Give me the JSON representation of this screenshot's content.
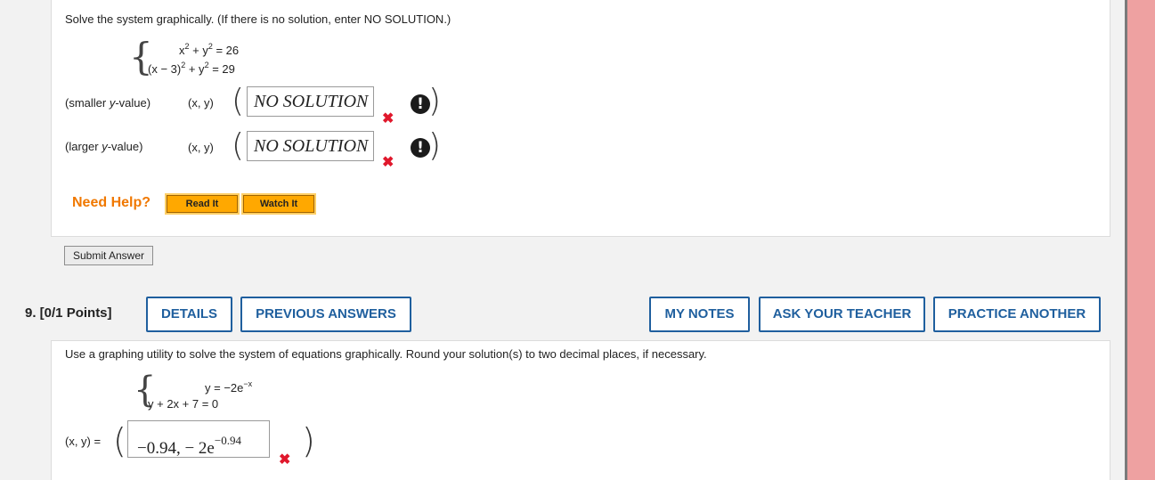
{
  "q8": {
    "prompt": "Solve the system graphically. (If there is no solution, enter NO SOLUTION.)",
    "eq1": {
      "lhs": "x",
      "exp": "2",
      "mid": " + y",
      "exp2": "2",
      "rhs": " = 26"
    },
    "eq2": {
      "lhs": "(x − 3)",
      "exp": "2",
      "mid": " + y",
      "exp2": "2",
      "rhs": " = 29"
    },
    "rows": [
      {
        "label_pre": "(smaller ",
        "label_var": "y",
        "label_post": "-value)",
        "var_label": "(x, y)",
        "answer": "NO SOLUTION"
      },
      {
        "label_pre": "(larger ",
        "label_var": "y",
        "label_post": "-value)",
        "var_label": "(x, y)",
        "answer": "NO SOLUTION"
      }
    ],
    "need_help": "Need Help?",
    "read_it": "Read It",
    "watch_it": "Watch It",
    "submit": "Submit Answer"
  },
  "q9": {
    "label": "9.  [0/1 Points]",
    "tabs": {
      "details": "DETAILS",
      "previous": "PREVIOUS ANSWERS",
      "notes": "MY NOTES",
      "ask": "ASK YOUR TEACHER",
      "practice": "PRACTICE ANOTHER"
    },
    "prompt": "Use a graphing utility to solve the system of equations graphically. Round your solution(s) to two decimal places, if necessary.",
    "eq1": {
      "lhs": "y = −2e",
      "exp": "−x"
    },
    "eq2": {
      "text": "y + 2x + 7 = 0"
    },
    "xy_label": "(x, y) =",
    "answer_main": "−0.94, − 2e",
    "answer_exp": "−0.94"
  },
  "colors": {
    "accent": "#1f5f9e",
    "error": "#e0182c",
    "help": "#f07800",
    "button": "#ffa800"
  },
  "icons": [
    "brace-icon",
    "x-mark-icon",
    "exclamation-icon"
  ]
}
